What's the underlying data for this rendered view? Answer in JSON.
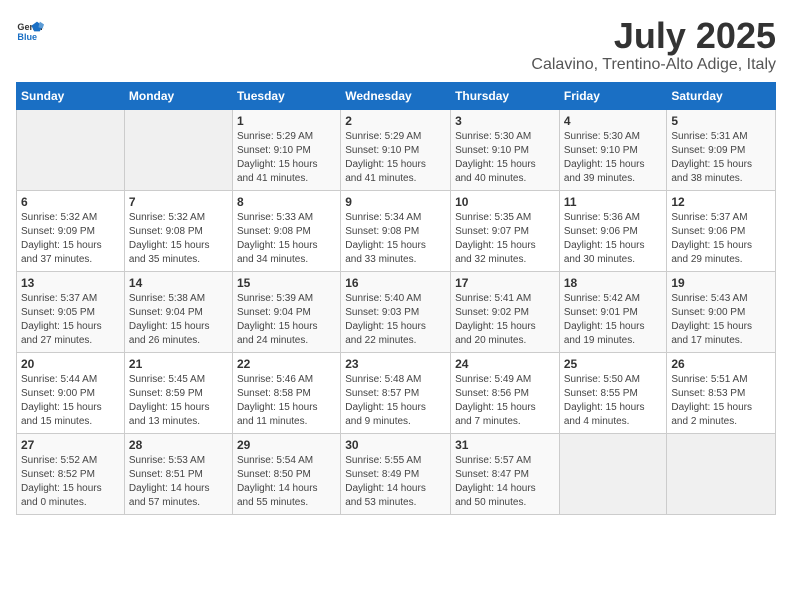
{
  "logo": {
    "line1": "General",
    "line2": "Blue"
  },
  "title": "July 2025",
  "subtitle": "Calavino, Trentino-Alto Adige, Italy",
  "days_header": [
    "Sunday",
    "Monday",
    "Tuesday",
    "Wednesday",
    "Thursday",
    "Friday",
    "Saturday"
  ],
  "weeks": [
    [
      {
        "num": "",
        "detail": ""
      },
      {
        "num": "",
        "detail": ""
      },
      {
        "num": "1",
        "detail": "Sunrise: 5:29 AM\nSunset: 9:10 PM\nDaylight: 15 hours\nand 41 minutes."
      },
      {
        "num": "2",
        "detail": "Sunrise: 5:29 AM\nSunset: 9:10 PM\nDaylight: 15 hours\nand 41 minutes."
      },
      {
        "num": "3",
        "detail": "Sunrise: 5:30 AM\nSunset: 9:10 PM\nDaylight: 15 hours\nand 40 minutes."
      },
      {
        "num": "4",
        "detail": "Sunrise: 5:30 AM\nSunset: 9:10 PM\nDaylight: 15 hours\nand 39 minutes."
      },
      {
        "num": "5",
        "detail": "Sunrise: 5:31 AM\nSunset: 9:09 PM\nDaylight: 15 hours\nand 38 minutes."
      }
    ],
    [
      {
        "num": "6",
        "detail": "Sunrise: 5:32 AM\nSunset: 9:09 PM\nDaylight: 15 hours\nand 37 minutes."
      },
      {
        "num": "7",
        "detail": "Sunrise: 5:32 AM\nSunset: 9:08 PM\nDaylight: 15 hours\nand 35 minutes."
      },
      {
        "num": "8",
        "detail": "Sunrise: 5:33 AM\nSunset: 9:08 PM\nDaylight: 15 hours\nand 34 minutes."
      },
      {
        "num": "9",
        "detail": "Sunrise: 5:34 AM\nSunset: 9:08 PM\nDaylight: 15 hours\nand 33 minutes."
      },
      {
        "num": "10",
        "detail": "Sunrise: 5:35 AM\nSunset: 9:07 PM\nDaylight: 15 hours\nand 32 minutes."
      },
      {
        "num": "11",
        "detail": "Sunrise: 5:36 AM\nSunset: 9:06 PM\nDaylight: 15 hours\nand 30 minutes."
      },
      {
        "num": "12",
        "detail": "Sunrise: 5:37 AM\nSunset: 9:06 PM\nDaylight: 15 hours\nand 29 minutes."
      }
    ],
    [
      {
        "num": "13",
        "detail": "Sunrise: 5:37 AM\nSunset: 9:05 PM\nDaylight: 15 hours\nand 27 minutes."
      },
      {
        "num": "14",
        "detail": "Sunrise: 5:38 AM\nSunset: 9:04 PM\nDaylight: 15 hours\nand 26 minutes."
      },
      {
        "num": "15",
        "detail": "Sunrise: 5:39 AM\nSunset: 9:04 PM\nDaylight: 15 hours\nand 24 minutes."
      },
      {
        "num": "16",
        "detail": "Sunrise: 5:40 AM\nSunset: 9:03 PM\nDaylight: 15 hours\nand 22 minutes."
      },
      {
        "num": "17",
        "detail": "Sunrise: 5:41 AM\nSunset: 9:02 PM\nDaylight: 15 hours\nand 20 minutes."
      },
      {
        "num": "18",
        "detail": "Sunrise: 5:42 AM\nSunset: 9:01 PM\nDaylight: 15 hours\nand 19 minutes."
      },
      {
        "num": "19",
        "detail": "Sunrise: 5:43 AM\nSunset: 9:00 PM\nDaylight: 15 hours\nand 17 minutes."
      }
    ],
    [
      {
        "num": "20",
        "detail": "Sunrise: 5:44 AM\nSunset: 9:00 PM\nDaylight: 15 hours\nand 15 minutes."
      },
      {
        "num": "21",
        "detail": "Sunrise: 5:45 AM\nSunset: 8:59 PM\nDaylight: 15 hours\nand 13 minutes."
      },
      {
        "num": "22",
        "detail": "Sunrise: 5:46 AM\nSunset: 8:58 PM\nDaylight: 15 hours\nand 11 minutes."
      },
      {
        "num": "23",
        "detail": "Sunrise: 5:48 AM\nSunset: 8:57 PM\nDaylight: 15 hours\nand 9 minutes."
      },
      {
        "num": "24",
        "detail": "Sunrise: 5:49 AM\nSunset: 8:56 PM\nDaylight: 15 hours\nand 7 minutes."
      },
      {
        "num": "25",
        "detail": "Sunrise: 5:50 AM\nSunset: 8:55 PM\nDaylight: 15 hours\nand 4 minutes."
      },
      {
        "num": "26",
        "detail": "Sunrise: 5:51 AM\nSunset: 8:53 PM\nDaylight: 15 hours\nand 2 minutes."
      }
    ],
    [
      {
        "num": "27",
        "detail": "Sunrise: 5:52 AM\nSunset: 8:52 PM\nDaylight: 15 hours\nand 0 minutes."
      },
      {
        "num": "28",
        "detail": "Sunrise: 5:53 AM\nSunset: 8:51 PM\nDaylight: 14 hours\nand 57 minutes."
      },
      {
        "num": "29",
        "detail": "Sunrise: 5:54 AM\nSunset: 8:50 PM\nDaylight: 14 hours\nand 55 minutes."
      },
      {
        "num": "30",
        "detail": "Sunrise: 5:55 AM\nSunset: 8:49 PM\nDaylight: 14 hours\nand 53 minutes."
      },
      {
        "num": "31",
        "detail": "Sunrise: 5:57 AM\nSunset: 8:47 PM\nDaylight: 14 hours\nand 50 minutes."
      },
      {
        "num": "",
        "detail": ""
      },
      {
        "num": "",
        "detail": ""
      }
    ]
  ]
}
